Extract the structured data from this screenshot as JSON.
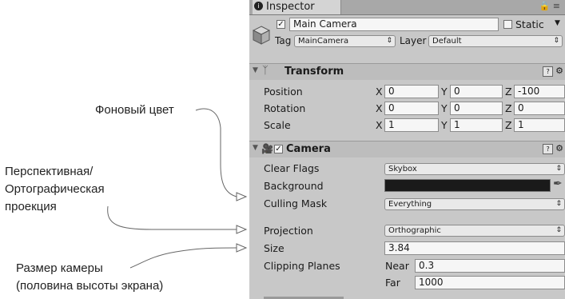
{
  "annotations": {
    "background_color": "Фоновый цвет",
    "projection_1": "Перспективная/",
    "projection_2": "Ортографическая",
    "projection_3": "проекция",
    "size_1": "Размер камеры",
    "size_2": "(половина высоты экрана)"
  },
  "tab": {
    "title": "Inspector",
    "icon": "info-icon"
  },
  "object": {
    "name": "Main Camera",
    "active": true,
    "static_label": "Static",
    "static": false,
    "tag_label": "Tag",
    "tag_value": "MainCamera",
    "layer_label": "Layer",
    "layer_value": "Default"
  },
  "transform": {
    "title": "Transform",
    "axes": [
      "X",
      "Y",
      "Z"
    ],
    "rows": [
      {
        "label": "Position",
        "values": [
          "0",
          "0",
          "-100"
        ]
      },
      {
        "label": "Rotation",
        "values": [
          "0",
          "0",
          "0"
        ]
      },
      {
        "label": "Scale",
        "values": [
          "1",
          "1",
          "1"
        ]
      }
    ]
  },
  "camera": {
    "title": "Camera",
    "enabled": true,
    "clear_flags_label": "Clear Flags",
    "clear_flags_value": "Skybox",
    "background_label": "Background",
    "background_color": "#1a1a1a",
    "culling_mask_label": "Culling Mask",
    "culling_mask_value": "Everything",
    "projection_label": "Projection",
    "projection_value": "Orthographic",
    "size_label": "Size",
    "size_value": "3.84",
    "clipping_label": "Clipping Planes",
    "near_label": "Near",
    "near_value": "0.3",
    "far_label": "Far",
    "far_value": "1000"
  }
}
